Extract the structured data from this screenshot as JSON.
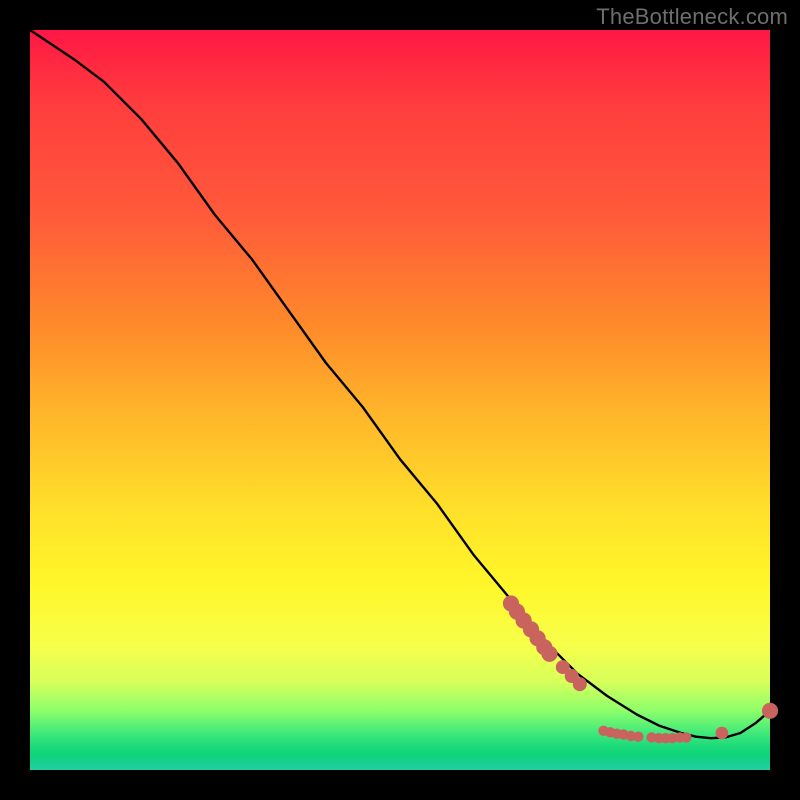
{
  "attribution": "TheBottleneck.com",
  "colors": {
    "dot": "#c9635e",
    "curve": "#000000",
    "gradient_top": "#ff1744",
    "gradient_bottom": "#23cfa4"
  },
  "chart_data": {
    "type": "line",
    "title": "",
    "xlabel": "",
    "ylabel": "",
    "xlim": [
      0,
      100
    ],
    "ylim": [
      0,
      100
    ],
    "grid": false,
    "legend": false,
    "note": "No axis ticks or labels rendered in source image; values are pixel-fraction estimates (0–100 along each axis, y=0 at bottom).",
    "series": [
      {
        "name": "curve",
        "x": [
          0,
          3,
          6,
          10,
          15,
          20,
          25,
          30,
          35,
          40,
          45,
          50,
          55,
          60,
          65,
          70,
          74,
          78,
          82,
          85,
          88,
          90,
          92,
          94,
          96,
          98,
          100
        ],
        "y": [
          100,
          98,
          96,
          93,
          88,
          82,
          75,
          69,
          62,
          55,
          49,
          42,
          36,
          29,
          23,
          17,
          13,
          10,
          7.5,
          6,
          5,
          4.5,
          4.3,
          4.4,
          5,
          6.3,
          8
        ]
      }
    ],
    "points": [
      {
        "x": 65.0,
        "y": 22.5,
        "r": 1.1
      },
      {
        "x": 65.8,
        "y": 21.4,
        "r": 1.1
      },
      {
        "x": 66.7,
        "y": 20.2,
        "r": 1.1
      },
      {
        "x": 67.7,
        "y": 19.0,
        "r": 1.1
      },
      {
        "x": 68.6,
        "y": 17.8,
        "r": 1.1
      },
      {
        "x": 69.5,
        "y": 16.6,
        "r": 1.1
      },
      {
        "x": 70.2,
        "y": 15.7,
        "r": 1.1
      },
      {
        "x": 72.0,
        "y": 13.9,
        "r": 0.95
      },
      {
        "x": 73.2,
        "y": 12.7,
        "r": 0.95
      },
      {
        "x": 74.3,
        "y": 11.6,
        "r": 0.95
      },
      {
        "x": 77.5,
        "y": 5.3,
        "r": 0.7
      },
      {
        "x": 78.4,
        "y": 5.1,
        "r": 0.7
      },
      {
        "x": 79.3,
        "y": 4.9,
        "r": 0.7
      },
      {
        "x": 80.2,
        "y": 4.8,
        "r": 0.7
      },
      {
        "x": 81.2,
        "y": 4.6,
        "r": 0.7
      },
      {
        "x": 82.2,
        "y": 4.5,
        "r": 0.7
      },
      {
        "x": 84.0,
        "y": 4.4,
        "r": 0.7
      },
      {
        "x": 85.0,
        "y": 4.3,
        "r": 0.7
      },
      {
        "x": 85.9,
        "y": 4.3,
        "r": 0.7
      },
      {
        "x": 86.8,
        "y": 4.3,
        "r": 0.7
      },
      {
        "x": 87.8,
        "y": 4.4,
        "r": 0.7
      },
      {
        "x": 88.7,
        "y": 4.4,
        "r": 0.7
      },
      {
        "x": 93.5,
        "y": 5.0,
        "r": 0.85
      },
      {
        "x": 100.0,
        "y": 8.0,
        "r": 1.1
      }
    ]
  }
}
